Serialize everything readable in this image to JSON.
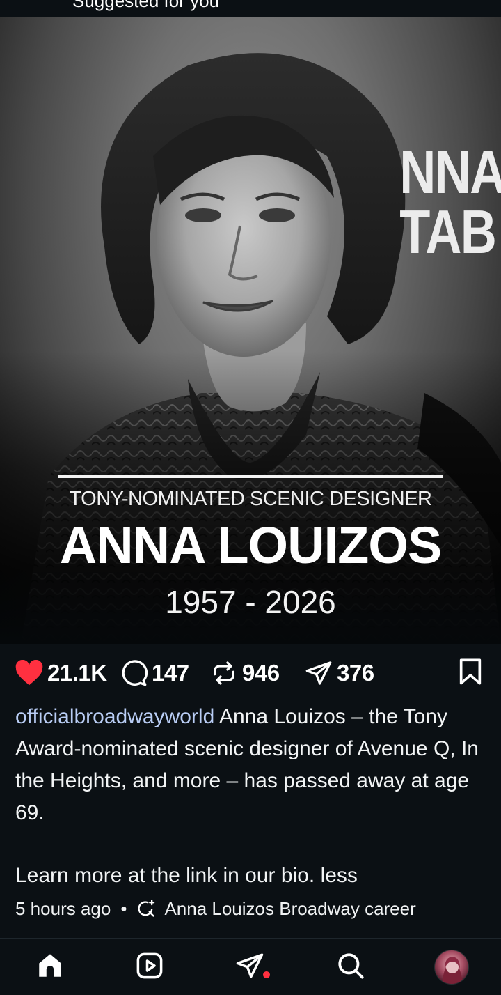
{
  "header": {
    "label": "Suggested for you"
  },
  "post": {
    "image": {
      "backdrop_letters": "NNA\nTAB",
      "subtitle": "TONY-NOMINATED SCENIC DESIGNER",
      "name": "ANNA LOUIZOS",
      "years": "1957 - 2026"
    },
    "actions": {
      "likes": "21.1K",
      "comments": "147",
      "reposts": "946",
      "shares": "376"
    },
    "caption": {
      "username": "officialbroadwayworld",
      "text": " Anna Louizos – the Tony Award-nominated scenic designer of Avenue Q, In the Heights, and more – has passed away at age 69.",
      "second_paragraph": "Learn more at the link in our bio. ",
      "less_label": "less"
    },
    "meta": {
      "time": "5 hours ago",
      "separator": "•",
      "search_suggestion": "Anna Louizos Broadway career"
    }
  },
  "bottom_nav": {
    "items": [
      "home-icon",
      "reels-icon",
      "direct-icon",
      "search-icon",
      "profile-avatar"
    ]
  },
  "colors": {
    "background": "#0b1014",
    "like_red": "#ff3040",
    "username_blue": "#b9cdf5"
  }
}
